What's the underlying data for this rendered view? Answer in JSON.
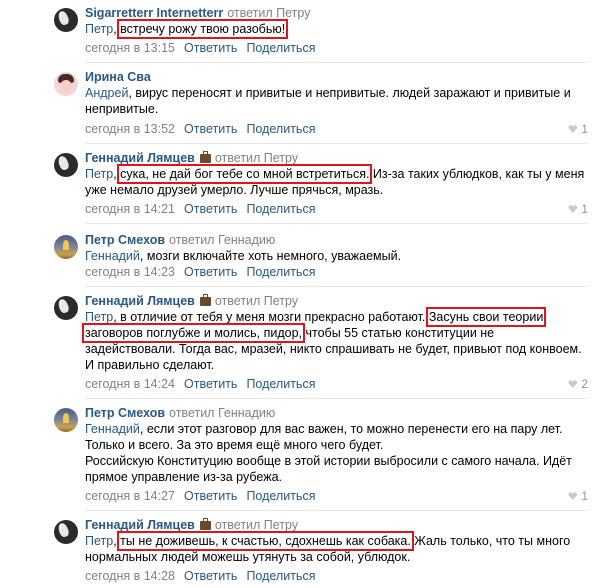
{
  "common": {
    "reply_label": "Ответить",
    "share_label": "Поделиться"
  },
  "comments": [
    {
      "author": "Sigarretterr Internetterr",
      "replied_text": "ответил Петру",
      "lines": [
        [
          {
            "t": "Петр",
            "k": "to"
          },
          {
            "t": ", ",
            "k": "p"
          },
          {
            "t": "встречу рожу твою разобью!",
            "k": "h"
          }
        ]
      ],
      "time": "сегодня в 13:15",
      "likes": ""
    },
    {
      "author": "Ирина Сва",
      "replied_text": "",
      "lines": [
        [
          {
            "t": "Андрей",
            "k": "to"
          },
          {
            "t": ", вирус переносят и привитые и непривитые. людей заражают и привитые и",
            "k": "p"
          }
        ],
        [
          {
            "t": "непривитые.",
            "k": "p"
          }
        ]
      ],
      "time": "сегодня в 13:52",
      "likes": "1"
    },
    {
      "author": "Геннадий Лямцев",
      "replied_text": "ответил Петру",
      "lines": [
        [
          {
            "t": "Петр",
            "k": "to"
          },
          {
            "t": ", ",
            "k": "p"
          },
          {
            "t": "сука, не дай бог тебе со мной встретиться.",
            "k": "h"
          },
          {
            "t": " Из-за таких ублюдков, как ты у меня",
            "k": "p"
          }
        ],
        [
          {
            "t": "уже немало друзей умерло. Лучше прячься, мразь.",
            "k": "p"
          }
        ]
      ],
      "time": "сегодня в 14:21",
      "likes": "1"
    },
    {
      "author": "Петр Смехов",
      "replied_text": "ответил Геннадию",
      "lines": [
        [
          {
            "t": "Геннадий",
            "k": "to"
          },
          {
            "t": ", мозги включайте хоть немного, уважаемый.",
            "k": "p"
          }
        ]
      ],
      "time": "сегодня в 14:23",
      "likes": ""
    },
    {
      "author": "Геннадий Лямцев",
      "replied_text": "ответил Петру",
      "lines": [
        [
          {
            "t": "Петр",
            "k": "to"
          },
          {
            "t": ", в отличие от тебя у меня мозги прекрасно работают. ",
            "k": "p"
          },
          {
            "t": "Засунь свои теории",
            "k": "h"
          }
        ],
        [
          {
            "t": "заговоров поглубже и молись, пидор,",
            "k": "h"
          },
          {
            "t": " чтобы 55 статью конституции не",
            "k": "p"
          }
        ],
        [
          {
            "t": "задействовали. Тогда вас, мразей, никто спрашивать не будет, привьют под конвоем.",
            "k": "p"
          }
        ],
        [
          {
            "t": "И правильно сделают.",
            "k": "p"
          }
        ]
      ],
      "time": "сегодня в 14:24",
      "likes": "2"
    },
    {
      "author": "Петр Смехов",
      "replied_text": "ответил Геннадию",
      "lines": [
        [
          {
            "t": "Геннадий",
            "k": "to"
          },
          {
            "t": ", если этот разговор для вас важен, то можно перенести его на пару лет.",
            "k": "p"
          }
        ],
        [
          {
            "t": "Только и всего. За это время ещё много чего будет.",
            "k": "p"
          }
        ],
        [
          {
            "t": "Российскую Конституцию вообще в этой истории выбросили с самого начала. Идёт",
            "k": "p"
          }
        ],
        [
          {
            "t": "прямое управление из-за рубежа.",
            "k": "p"
          }
        ]
      ],
      "time": "сегодня в 14:27",
      "likes": "1"
    },
    {
      "author": "Геннадий Лямцев",
      "replied_text": "ответил Петру",
      "lines": [
        [
          {
            "t": "Петр",
            "k": "to"
          },
          {
            "t": ", ",
            "k": "p"
          },
          {
            "t": "ты не доживешь, к счастью, сдохнешь как собака.",
            "k": "h"
          },
          {
            "t": " Жаль только, что ты много",
            "k": "p"
          }
        ],
        [
          {
            "t": "нормальных людей можешь утянуть за собой, ублюдок.",
            "k": "p"
          }
        ]
      ],
      "time": "сегодня в 14:28",
      "likes": ""
    }
  ]
}
